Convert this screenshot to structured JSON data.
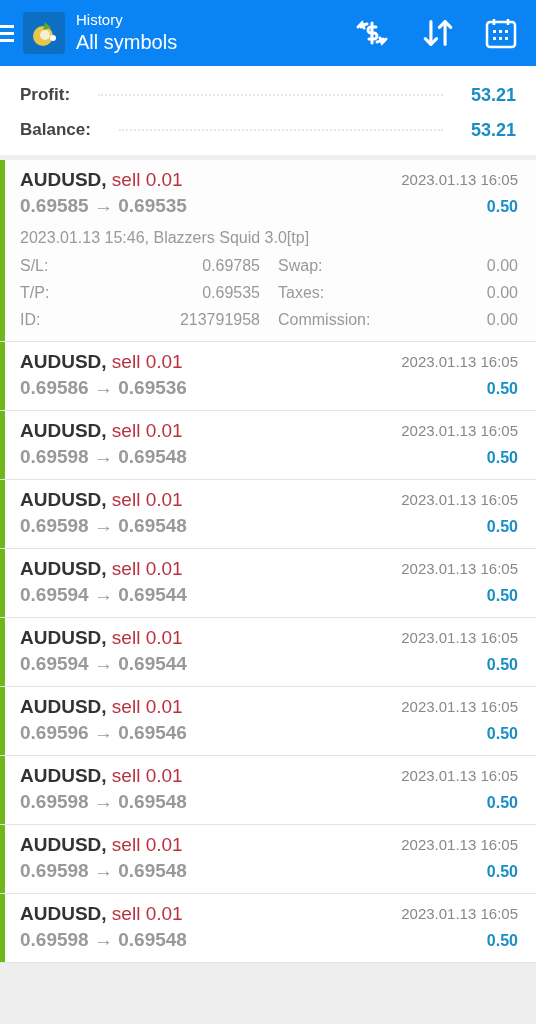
{
  "header": {
    "subtitle": "History",
    "title": "All symbols"
  },
  "summary": [
    {
      "label": "Profit:",
      "value": "53.21"
    },
    {
      "label": "Balance:",
      "value": "53.21"
    }
  ],
  "deals": [
    {
      "symbol": "AUDUSD,",
      "type": "sell 0.01",
      "prices": "0.69585 → 0.69535",
      "time": "2023.01.13 16:05",
      "profit": "0.50",
      "expanded": true,
      "info": "2023.01.13 15:46, Blazzers Squid 3.0[tp]",
      "details": [
        {
          "label": "S/L:",
          "value": "0.69785"
        },
        {
          "label": "Swap:",
          "value": "0.00"
        },
        {
          "label": "T/P:",
          "value": "0.69535"
        },
        {
          "label": "Taxes:",
          "value": "0.00"
        },
        {
          "label": "ID:",
          "value": "213791958"
        },
        {
          "label": "Commission:",
          "value": "0.00"
        }
      ]
    },
    {
      "symbol": "AUDUSD,",
      "type": "sell 0.01",
      "prices": "0.69586 → 0.69536",
      "time": "2023.01.13 16:05",
      "profit": "0.50",
      "expanded": false
    },
    {
      "symbol": "AUDUSD,",
      "type": "sell 0.01",
      "prices": "0.69598 → 0.69548",
      "time": "2023.01.13 16:05",
      "profit": "0.50",
      "expanded": false
    },
    {
      "symbol": "AUDUSD,",
      "type": "sell 0.01",
      "prices": "0.69598 → 0.69548",
      "time": "2023.01.13 16:05",
      "profit": "0.50",
      "expanded": false
    },
    {
      "symbol": "AUDUSD,",
      "type": "sell 0.01",
      "prices": "0.69594 → 0.69544",
      "time": "2023.01.13 16:05",
      "profit": "0.50",
      "expanded": false
    },
    {
      "symbol": "AUDUSD,",
      "type": "sell 0.01",
      "prices": "0.69594 → 0.69544",
      "time": "2023.01.13 16:05",
      "profit": "0.50",
      "expanded": false
    },
    {
      "symbol": "AUDUSD,",
      "type": "sell 0.01",
      "prices": "0.69596 → 0.69546",
      "time": "2023.01.13 16:05",
      "profit": "0.50",
      "expanded": false
    },
    {
      "symbol": "AUDUSD,",
      "type": "sell 0.01",
      "prices": "0.69598 → 0.69548",
      "time": "2023.01.13 16:05",
      "profit": "0.50",
      "expanded": false
    },
    {
      "symbol": "AUDUSD,",
      "type": "sell 0.01",
      "prices": "0.69598 → 0.69548",
      "time": "2023.01.13 16:05",
      "profit": "0.50",
      "expanded": false
    },
    {
      "symbol": "AUDUSD,",
      "type": "sell 0.01",
      "prices": "0.69598 → 0.69548",
      "time": "2023.01.13 16:05",
      "profit": "0.50",
      "expanded": false
    }
  ]
}
